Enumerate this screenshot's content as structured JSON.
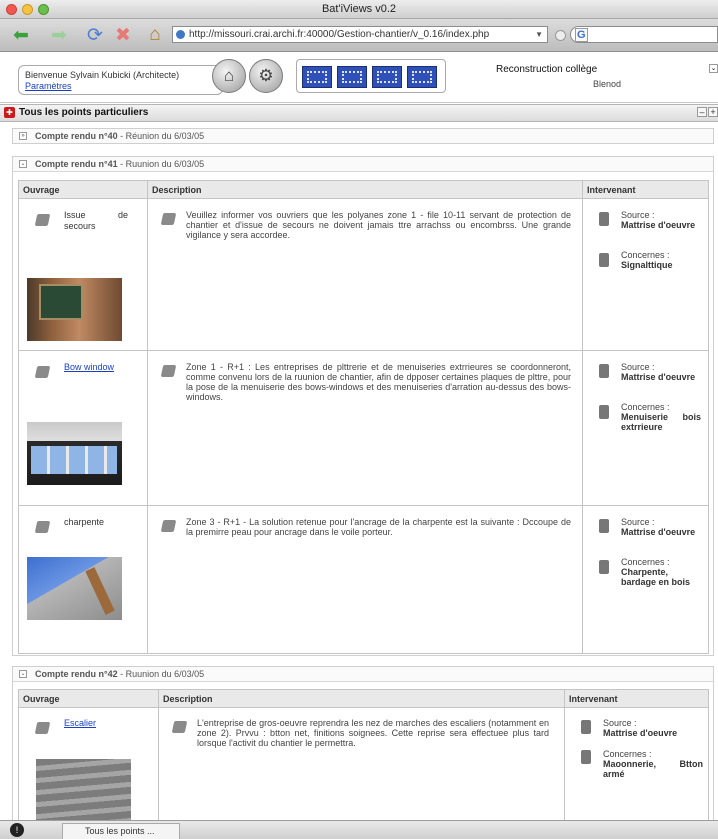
{
  "window": {
    "title": "Bat'iViews v0.2"
  },
  "browser": {
    "url": "http://missouri.crai.archi.fr:40000/Gestion-chantier/v_0.16/index.php",
    "search_logo": "G"
  },
  "header": {
    "welcome": "Bienvenue Sylvain Kubicki (Architecte)",
    "settings_link": "Paramètres",
    "project": "Reconstruction collège",
    "location": "Blenod"
  },
  "panel": {
    "title": "Tous les points particuliers"
  },
  "columns": {
    "ouvrage": "Ouvrage",
    "description": "Description",
    "intervenant": "Intervenant"
  },
  "labels": {
    "source": "Source :",
    "concernes": "Concernes :"
  },
  "reports": [
    {
      "title": "Compte rendu n°40",
      "date": " - Réunion du 6/03/05",
      "expanded": false
    },
    {
      "title": "Compte rendu n°41",
      "date": " - Ruunion du 6/03/05",
      "expanded": true,
      "items": [
        {
          "ouvrage": "Issue de secours",
          "is_link": false,
          "description": "Veuillez informer vos ouvriers que les polyanes zone 1 - file 10-11 servant de protection de chantier et d'issue de secours ne doivent jamais ttre arrachss ou encombrss. Une grande vigilance y sera accordee.",
          "source": "Mattrise d'oeuvre",
          "concernes": "Signalttique"
        },
        {
          "ouvrage": "Bow window",
          "is_link": true,
          "description": "Zone 1 - R+1 : Les entreprises de plttrerie et de menuiseries extrrieures se coordonneront, comme convenu lors de la ruunion de chantier, afin de dpposer certaines plaques de plttre, pour la pose de la menuiserie des bows-windows et des menuiseries d'arration au-dessus des bows-windows.",
          "source": "Mattrise d'oeuvre",
          "concernes": "Menuiserie bois extrrieure"
        },
        {
          "ouvrage": "charpente",
          "is_link": false,
          "description": "Zone 3 - R+1 - La solution retenue pour l'ancrage de la charpente est la suivante : Dccoupe de la premirre peau pour ancrage dans le voile porteur.",
          "source": "Mattrise d'oeuvre",
          "concernes": "Charpente, bardage en bois"
        }
      ]
    },
    {
      "title": "Compte rendu n°42",
      "date": " - Ruunion du 6/03/05",
      "expanded": true,
      "items": [
        {
          "ouvrage": "Escalier",
          "is_link": true,
          "description": "L'entreprise de gros-oeuvre reprendra les nez de marches des escaliers (notamment en zone 2). Prvvu : btton net, finitions soignees. Cette reprise sera effectuee plus tard lorsque l'activit du chantier le permettra.",
          "source": "Mattrise d'oeuvre",
          "concernes": "Maoonnerie, Btton armé"
        }
      ]
    }
  ],
  "statusbar": {
    "tab_label": "Tous les points ..."
  }
}
